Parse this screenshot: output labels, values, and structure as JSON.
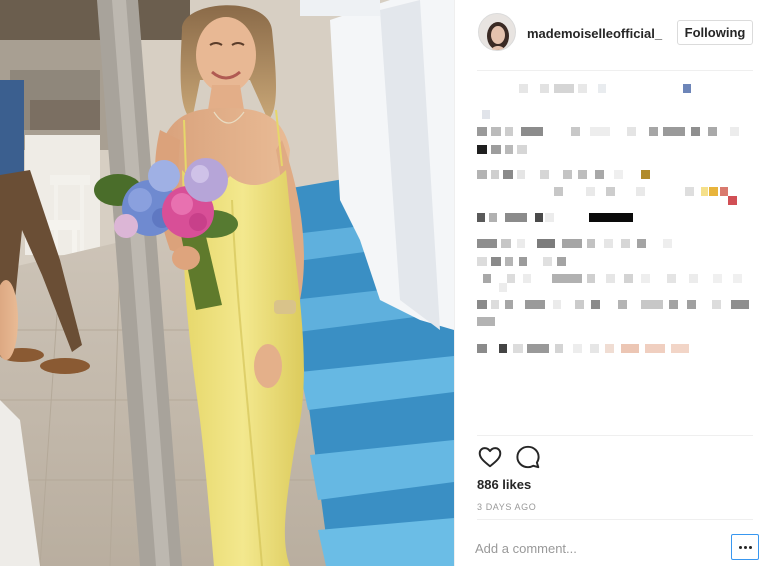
{
  "post": {
    "username": "mademoiselleofficial_",
    "follow_label": "Following",
    "likes_text": "886 likes",
    "date_text": "3 DAYS AGO",
    "comment_placeholder": "Add a comment...",
    "more_icon": "ellipsis-icon",
    "like_icon": "heart-outline-icon",
    "comment_icon": "speech-bubble-icon"
  },
  "colors": {
    "text": "#262626",
    "muted": "#999999",
    "border": "#dbdbdb",
    "focus_blue": "#3897f0"
  }
}
